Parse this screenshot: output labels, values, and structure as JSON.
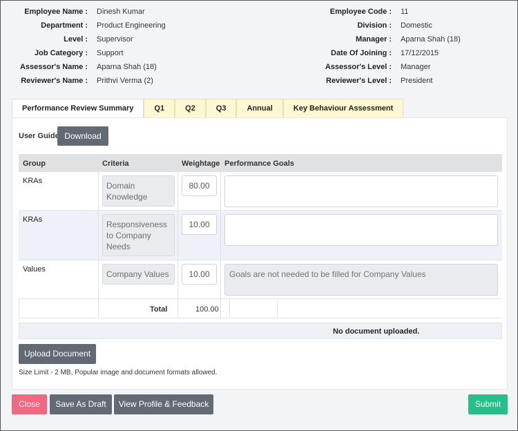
{
  "employee": {
    "left": [
      {
        "label": "Employee Name :",
        "value": "Dinesh Kumar"
      },
      {
        "label": "Department :",
        "value": "Product Engineering"
      },
      {
        "label": "Level :",
        "value": "Supervisor"
      },
      {
        "label": "Job Category :",
        "value": "Support"
      },
      {
        "label": "Assessor's Name :",
        "value": "Aparna Shah (18)"
      },
      {
        "label": "Reviewer's Name :",
        "value": "Prithvi Verma (2)"
      }
    ],
    "right": [
      {
        "label": "Employee Code :",
        "value": "11"
      },
      {
        "label": "Division :",
        "value": "Domestic"
      },
      {
        "label": "Manager :",
        "value": "Aparna Shah (18)"
      },
      {
        "label": "Date Of Joining :",
        "value": "17/12/2015"
      },
      {
        "label": "Assessor's Level :",
        "value": "Manager"
      },
      {
        "label": "Reviewer's Level :",
        "value": "President"
      }
    ]
  },
  "tabs": [
    {
      "label": "Performance Review Summary",
      "active": true
    },
    {
      "label": "Q1"
    },
    {
      "label": "Q2"
    },
    {
      "label": "Q3"
    },
    {
      "label": "Annual"
    },
    {
      "label": "Key Behaviour Assessment"
    }
  ],
  "user_guide": {
    "label": "User Guide",
    "download_label": "Download"
  },
  "table": {
    "headers": {
      "group": "Group",
      "criteria": "Criteria",
      "weightage": "Weightage",
      "goals": "Performance Goals"
    },
    "rows": [
      {
        "group": "KRAs",
        "criteria": "Domain Knowledge",
        "weightage": "80.00",
        "goal": "",
        "goal_placeholder": ""
      },
      {
        "group": "KRAs",
        "criteria": "Responsiveness to Company Needs",
        "weightage": "10.00",
        "goal": "",
        "goal_placeholder": ""
      },
      {
        "group": "Values",
        "criteria": "Company Values",
        "weightage": "10.00",
        "goal": "",
        "goal_placeholder": "Goals are not needed to be filled for Company Values"
      }
    ],
    "total_label": "Total",
    "total_value": "100.00"
  },
  "documents": {
    "status": "No document uploaded.",
    "upload_label": "Upload Document",
    "size_limit": "Size Limit - 2 MB, Popular image and document formats allowed."
  },
  "footer": {
    "close_label": "Close",
    "draft_label": "Save As Draft",
    "profile_label": "View Profile & Feedback",
    "submit_label": "Submit"
  },
  "colors": {
    "close": "#f4687f",
    "submit": "#23c087",
    "tab_inactive": "#fdf8d2",
    "button_gray": "#646a73"
  }
}
